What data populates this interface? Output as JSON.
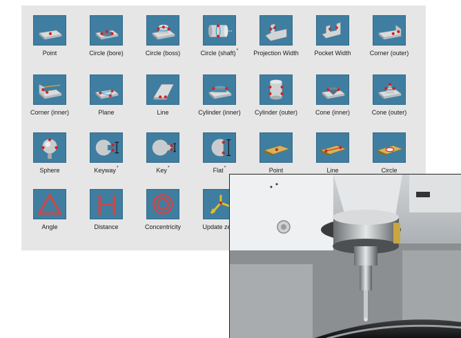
{
  "panel": {
    "rows": [
      [
        {
          "label": "Point",
          "icon": "point-icon"
        },
        {
          "label": "Circle (bore)",
          "icon": "circle-bore-icon"
        },
        {
          "label": "Circle (boss)",
          "icon": "circle-boss-icon"
        },
        {
          "label": "Circle (shaft)",
          "star": "*",
          "icon": "circle-shaft-icon"
        },
        {
          "label": "Projection Width",
          "icon": "projection-width-icon"
        },
        {
          "label": "Pocket Width",
          "icon": "pocket-width-icon"
        },
        {
          "label": "Corner (outer)",
          "icon": "corner-outer-icon"
        }
      ],
      [
        {
          "label": "Corner (inner)",
          "icon": "corner-inner-icon"
        },
        {
          "label": "Plane",
          "icon": "plane-icon"
        },
        {
          "label": "Line",
          "icon": "line-icon"
        },
        {
          "label": "Cylinder (inner)",
          "icon": "cylinder-inner-icon"
        },
        {
          "label": "Cylinder (outer)",
          "icon": "cylinder-outer-icon"
        },
        {
          "label": "Cone (inner)",
          "icon": "cone-inner-icon"
        },
        {
          "label": "Cone (outer)",
          "icon": "cone-outer-icon"
        }
      ],
      [
        {
          "label": "Sphere",
          "icon": "sphere-icon"
        },
        {
          "label": "Keyway",
          "star": "*",
          "icon": "keyway-icon"
        },
        {
          "label": "Key",
          "star": "*",
          "icon": "key-icon"
        },
        {
          "label": "Flat",
          "star": "*",
          "icon": "flat-icon"
        },
        {
          "label": "Point",
          "icon": "point-2d-icon"
        },
        {
          "label": "Line",
          "icon": "line-2d-icon"
        },
        {
          "label": "Circle",
          "icon": "circle-2d-icon"
        }
      ],
      [
        {
          "label": "Angle",
          "icon": "angle-icon"
        },
        {
          "label": "Distance",
          "icon": "distance-icon"
        },
        {
          "label": "Concentricity",
          "icon": "concentricity-icon"
        },
        {
          "label": "Update zero",
          "icon": "update-zero-icon"
        }
      ]
    ]
  },
  "colors": {
    "panel_bg": "#e6e6e6",
    "tile_bg": "#3f7ea0",
    "accent_red": "#d42020"
  }
}
